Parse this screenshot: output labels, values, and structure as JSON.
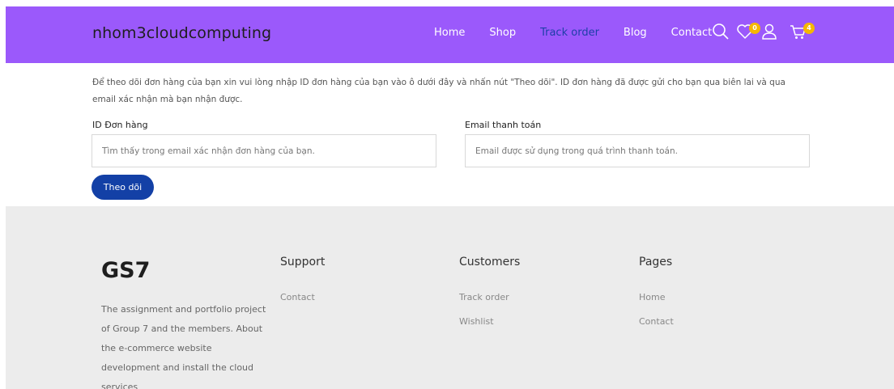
{
  "header": {
    "brand": "nhom3cloudcomputing",
    "nav": [
      "Home",
      "Shop",
      "Track order",
      "Blog",
      "Contact"
    ],
    "wishlist_count": "0",
    "cart_count": "4",
    "bg_color": "#9b59fb",
    "active_color": "#1d3fa8"
  },
  "content": {
    "description": "Để theo dõi đơn hàng của bạn xin vui lòng nhập ID đơn hàng của bạn vào ô dưới đây và nhấn nút \"Theo dõi\". ID đơn hàng đã được gửi cho bạn qua biên lai và qua email xác nhận mà bạn nhận được.",
    "order_id_label": "ID Đơn hàng",
    "order_id_placeholder": "Tìm thấy trong email xác nhận đơn hàng của bạn.",
    "email_label": "Email thanh toán",
    "email_placeholder": "Email được sử dụng trong quá trình thanh toán.",
    "track_button": "Theo dõi",
    "button_color": "#1340a6"
  },
  "footer": {
    "logo": "GS7",
    "about": "The assignment and portfolio project of Group 7 and the members. About the e-commerce website development and install the cloud services",
    "columns": [
      {
        "title": "Support",
        "links": [
          "Contact"
        ]
      },
      {
        "title": "Customers",
        "links": [
          "Track order",
          "Wishlist"
        ]
      },
      {
        "title": "Pages",
        "links": [
          "Home",
          "Contact"
        ]
      }
    ],
    "bg_color": "#ececec"
  }
}
